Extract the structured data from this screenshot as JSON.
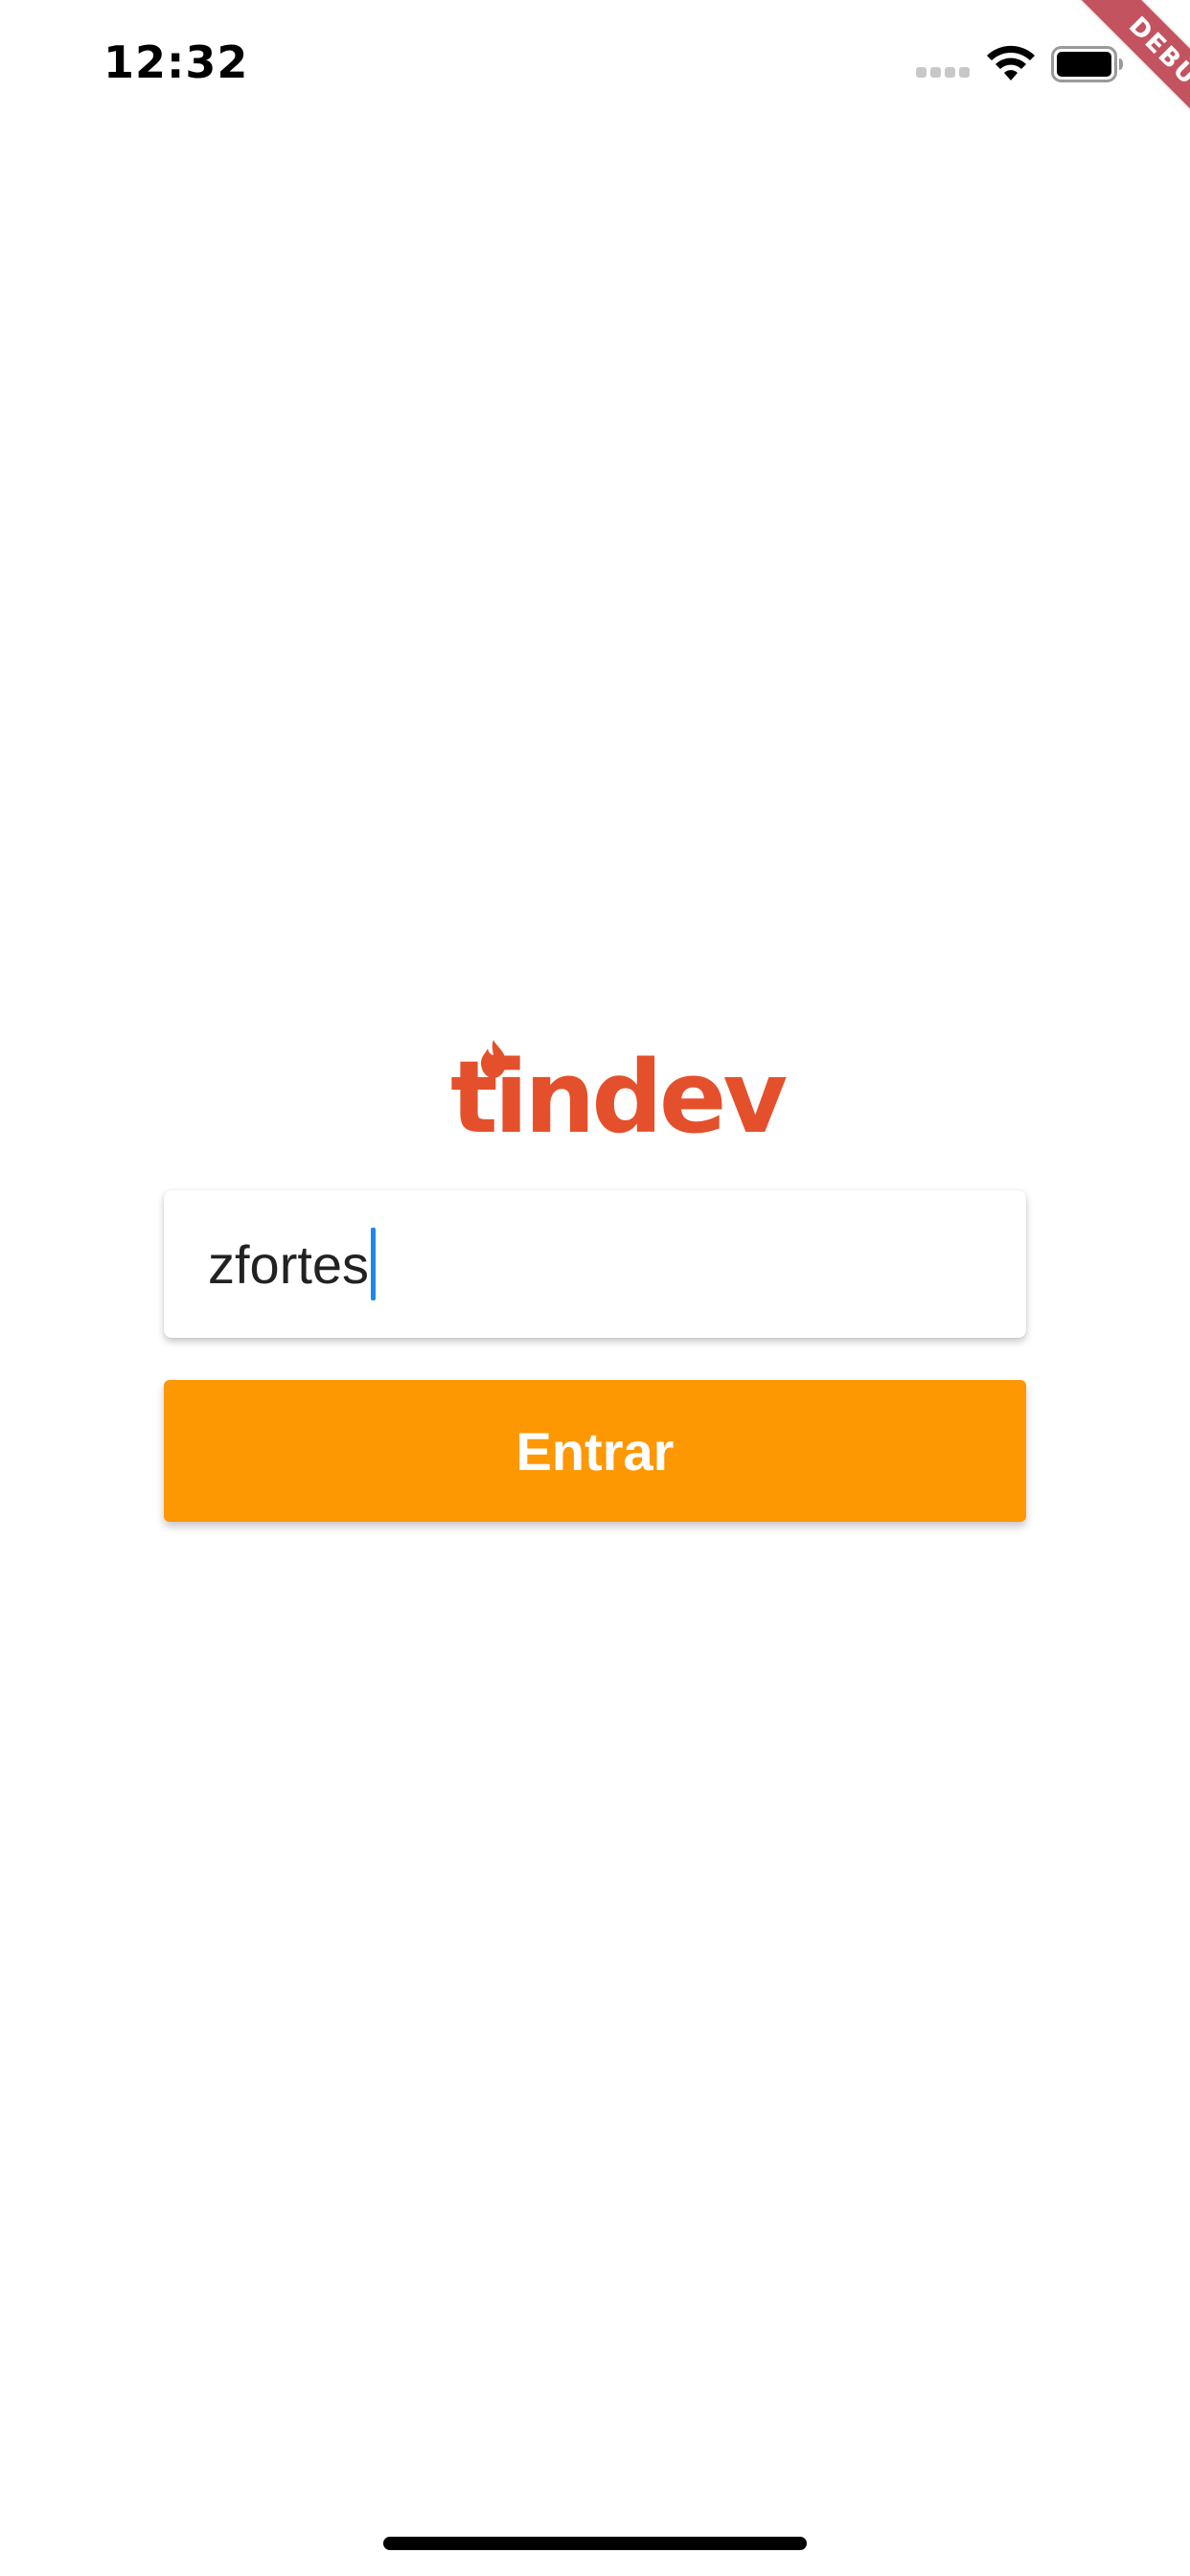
{
  "status_bar": {
    "time": "12:32",
    "icons": [
      "cellular-signal-icon",
      "wifi-icon",
      "battery-icon"
    ]
  },
  "debug_banner": {
    "label": "DEBUG"
  },
  "logo": {
    "text": "tindev",
    "icon": "flame-icon",
    "color": "#e4502b"
  },
  "login": {
    "username_value": "zfortes",
    "submit_label": "Entrar",
    "button_color": "#fd9702",
    "cursor_color": "#1e88e5"
  }
}
